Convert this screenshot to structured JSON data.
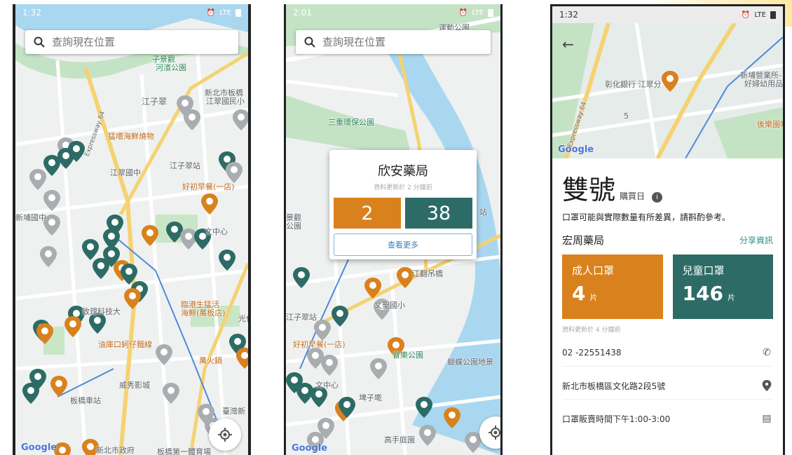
{
  "colors": {
    "orange": "#d9811d",
    "teal": "#2d6b66",
    "gray_pin": "#a9adb0",
    "link_blue": "#3a7fb8",
    "share_teal": "#2e8c86"
  },
  "screen1": {
    "status": {
      "time": "1:32",
      "right": "LTE"
    },
    "search": {
      "placeholder": "查詢現在位置",
      "icon": "search-icon"
    },
    "labels": {
      "l1": "子景觀",
      "l1b": "河濱公園",
      "l2": "江子翠",
      "l3": "新北市板橋",
      "l3b": "江翠國民小",
      "l4": "猛嚐海鮮燒物",
      "l5": "江翠國中",
      "l6": "江子翠站",
      "l7": "好初早餐(一店)",
      "l8": "新埔國中",
      "l9": "文中心",
      "l10": "致理科技大",
      "l11": "臨港生猛活",
      "l11b": "海鮮(萬板店)",
      "l12": "油庫口蚵仔麵線",
      "l13": "威秀影城",
      "l14": "板橋車站",
      "l15": "新北市政府",
      "l16": "板橋第一體育場",
      "l17": "臺灣新",
      "l18": "光仁",
      "l19": "萬火鍋",
      "l20": "Expressway 64"
    },
    "google": "Google"
  },
  "screen2": {
    "status": {
      "time": "2:01",
      "right": "LTE"
    },
    "search": {
      "placeholder": "查詢現在位置",
      "icon": "search-icon"
    },
    "labels": {
      "m1": "三重環保公園",
      "m2": "運動公園",
      "m3": "文聖國小",
      "m4": "江子翠站",
      "m5": "好初早餐(一店)",
      "m6": "音樂公園",
      "m7": "蝴蝶公園地景",
      "m8": "高手庭園",
      "m9": "埤子墘",
      "m10": "文中心",
      "m11": "江翻吊橋",
      "m12": "景觀",
      "m13": "公園",
      "m14": "站"
    },
    "popup": {
      "title": "欣安藥局",
      "updated": "資料更新於 2 分鐘前",
      "adult": "2",
      "child": "38",
      "more": "查看更多"
    },
    "google": "Google"
  },
  "screen3": {
    "status": {
      "time": "1:32",
      "right": "LTE"
    },
    "map_labels": {
      "b1": "彰化銀行 江翠分",
      "b2": "新埔營業所-",
      "b2b": "好婦幼用品",
      "b3": "後樂園叮",
      "b4": "Expressway 64",
      "b5": "5"
    },
    "google": "Google",
    "title": "雙號",
    "title_sub": "購買日",
    "note": "口罩可能與實際數量有所差異，請斟酌參考。",
    "pharmacy": "宏周藥局",
    "share": "分享資訊",
    "adult_label": "成人口罩",
    "adult_value": "4",
    "child_label": "兒童口罩",
    "child_value": "146",
    "unit": "片",
    "updated": "資料更新於 4 分鐘前",
    "phone": "02 -22551438",
    "address": "新北市板橋區文化路2段5號",
    "hours": "口罩販賣時間下午1:00-3:00"
  }
}
